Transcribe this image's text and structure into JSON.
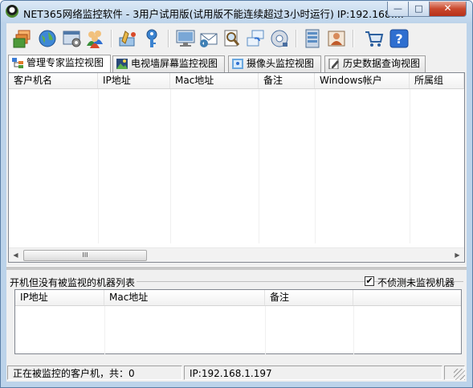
{
  "window": {
    "title": "NET365网络监控软件 - 3用户试用版(试用版不能连续超过3小时运行) IP:192.168....",
    "controls": {
      "minimize": "—",
      "maximize": "□",
      "close": "✕"
    }
  },
  "toolbar": {
    "buttons": [
      {
        "icon": "stack-windows-icon",
        "color": "#d8742a"
      },
      {
        "icon": "globe-icon",
        "color": "#2a72c8"
      },
      {
        "icon": "settings-window-icon",
        "color": "#5b7fa8"
      },
      {
        "icon": "users-group-icon",
        "color": "#3a8f3a"
      },
      {
        "icon": "network-edit-icon",
        "color": "#4a8ccc"
      },
      {
        "icon": "key-icon",
        "color": "#3b83d0"
      },
      {
        "icon": "monitor-icon",
        "color": "#4f6d8f"
      },
      {
        "icon": "email-icon",
        "color": "#3f7fb4"
      },
      {
        "icon": "magnifier-document-icon",
        "color": "#7a5a2a"
      },
      {
        "icon": "multi-window-icon",
        "color": "#5c8ec4"
      },
      {
        "icon": "disc-icon",
        "color": "#4a6fa0"
      },
      {
        "icon": "server-icon",
        "color": "#4f6f92"
      },
      {
        "icon": "person-card-icon",
        "color": "#c05a2a"
      },
      {
        "icon": "shopping-cart-icon",
        "color": "#2c5f9e"
      },
      {
        "icon": "help-icon",
        "color": "#2f6fd0"
      }
    ]
  },
  "tabs": [
    {
      "label": "管理专家监控视图",
      "icon": "tree-view-icon",
      "active": true
    },
    {
      "label": "电视墙屏幕监控视图",
      "icon": "picture-icon",
      "active": false
    },
    {
      "label": "摄像头监控视图",
      "icon": "camera-view-icon",
      "active": false
    },
    {
      "label": "历史数据查询视图",
      "icon": "pencil-document-icon",
      "active": false
    }
  ],
  "main_table": {
    "columns": [
      "客户机名",
      "IP地址",
      "Mac地址",
      "备注",
      "Windows帐户",
      "所属组"
    ],
    "rows": []
  },
  "scrollbar": {
    "left_arrow": "◀",
    "right_arrow": "▶",
    "thumb_grip": "III"
  },
  "lower": {
    "title": "开机但没有被监视的机器列表",
    "checkbox_label": "不侦测未监视机器",
    "checkbox_checked": true,
    "checkbox_mark": "✔",
    "columns": [
      "IP地址",
      "Mac地址",
      "备注",
      ""
    ]
  },
  "status": {
    "monitored_count": "正在被监控的客户机，共：0",
    "ip": "IP:192.168.1.197"
  }
}
